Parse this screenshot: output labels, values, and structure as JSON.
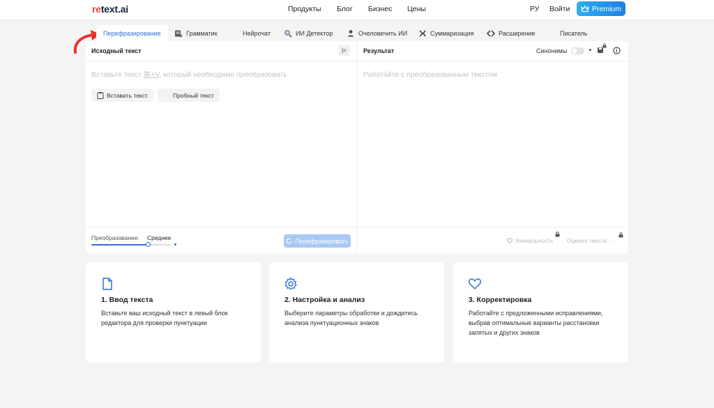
{
  "header": {
    "logo_re": "re",
    "logo_rest": "text.ai",
    "nav": [
      "Продукты",
      "Блог",
      "Бизнес",
      "Цены"
    ],
    "lang": "РУ",
    "login": "Войти",
    "premium": "Premium"
  },
  "tabs": [
    {
      "label": "Перефразирование",
      "icon": "paraphrase-icon",
      "active": true
    },
    {
      "label": "Грамматик",
      "icon": "grammar-icon"
    },
    {
      "label": "Нейрочат",
      "icon": "none"
    },
    {
      "label": "ИИ Детектор",
      "icon": "detector-icon"
    },
    {
      "label": "Очеловечить ИИ",
      "icon": "person-icon"
    },
    {
      "label": "Суммаризация",
      "icon": "summarize-icon"
    },
    {
      "label": "Расширение",
      "icon": "expand-icon"
    },
    {
      "label": "Писатель",
      "icon": "none"
    }
  ],
  "source": {
    "title": "Исходный текст",
    "collapse": "|<",
    "placeholder_pre": "Вставьте текст ",
    "placeholder_key": "⌘+V",
    "placeholder_post": ", который необходимо преобразовать",
    "paste_btn": "Вставить текст",
    "sample_btn": "Пробный текст",
    "mode_label": "Преобразование:",
    "mode_value": "Среднее",
    "mode_level": 0.5,
    "paraphrase_btn": "Перефразировать"
  },
  "result": {
    "title": "Результат",
    "synonyms": "Синонимы",
    "placeholder": "Работайте с преобразованным текстом",
    "uniqueness": "Уникальность",
    "score": "Оценка текста:",
    "score_value": "-"
  },
  "steps": [
    {
      "title": "1. Ввод текста",
      "text": "Вставьте ваш исходный текст в левый блок редактора для проверки пунктуации",
      "icon": "document-icon"
    },
    {
      "title": "2. Настройка и анализ",
      "text": "Выберите параметры обработки и дождитесь анализа пунктуационных знаков",
      "icon": "gear-icon"
    },
    {
      "title": "3. Корректировка",
      "text": "Работайте с предложенными исправлениями, выбрав оптимальные варианты расстановки запятых и других знаков",
      "icon": "heart-icon"
    }
  ],
  "colors": {
    "accent": "#2c6fd6",
    "premium": "#1e7fe3",
    "arrow": "#e8332a"
  }
}
